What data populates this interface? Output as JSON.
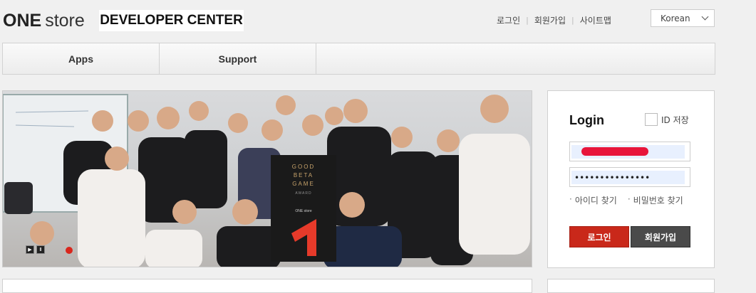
{
  "header": {
    "logo_one": "ONE",
    "logo_store": "store",
    "dev_center": "DEVELOPER CENTER",
    "links": [
      "로그인",
      "회원가입",
      "사이트맵"
    ],
    "language": "Korean"
  },
  "nav": {
    "tabs": [
      "Apps",
      "Support"
    ]
  },
  "banner": {
    "poster_lines": [
      "GOOD",
      "BETA",
      "GAME",
      "AWARD"
    ],
    "poster_brand": "ONE store",
    "active_slide": 1
  },
  "login": {
    "title": "Login",
    "save_id": "ID 저장",
    "id_value": "",
    "password_value": "•••••••••••••••",
    "find_id": "아이디 찾기",
    "find_password": "비밀번호 찾기",
    "login_button": "로그인",
    "join_button": "회원가입"
  },
  "colors": {
    "accent_red": "#c9281a",
    "dark_button": "#4a4a4a",
    "autofill_blue": "#e8f0fe"
  },
  "icons": [
    "play-icon",
    "pause-icon",
    "slide-indicator-dot",
    "chevron-down-icon"
  ]
}
